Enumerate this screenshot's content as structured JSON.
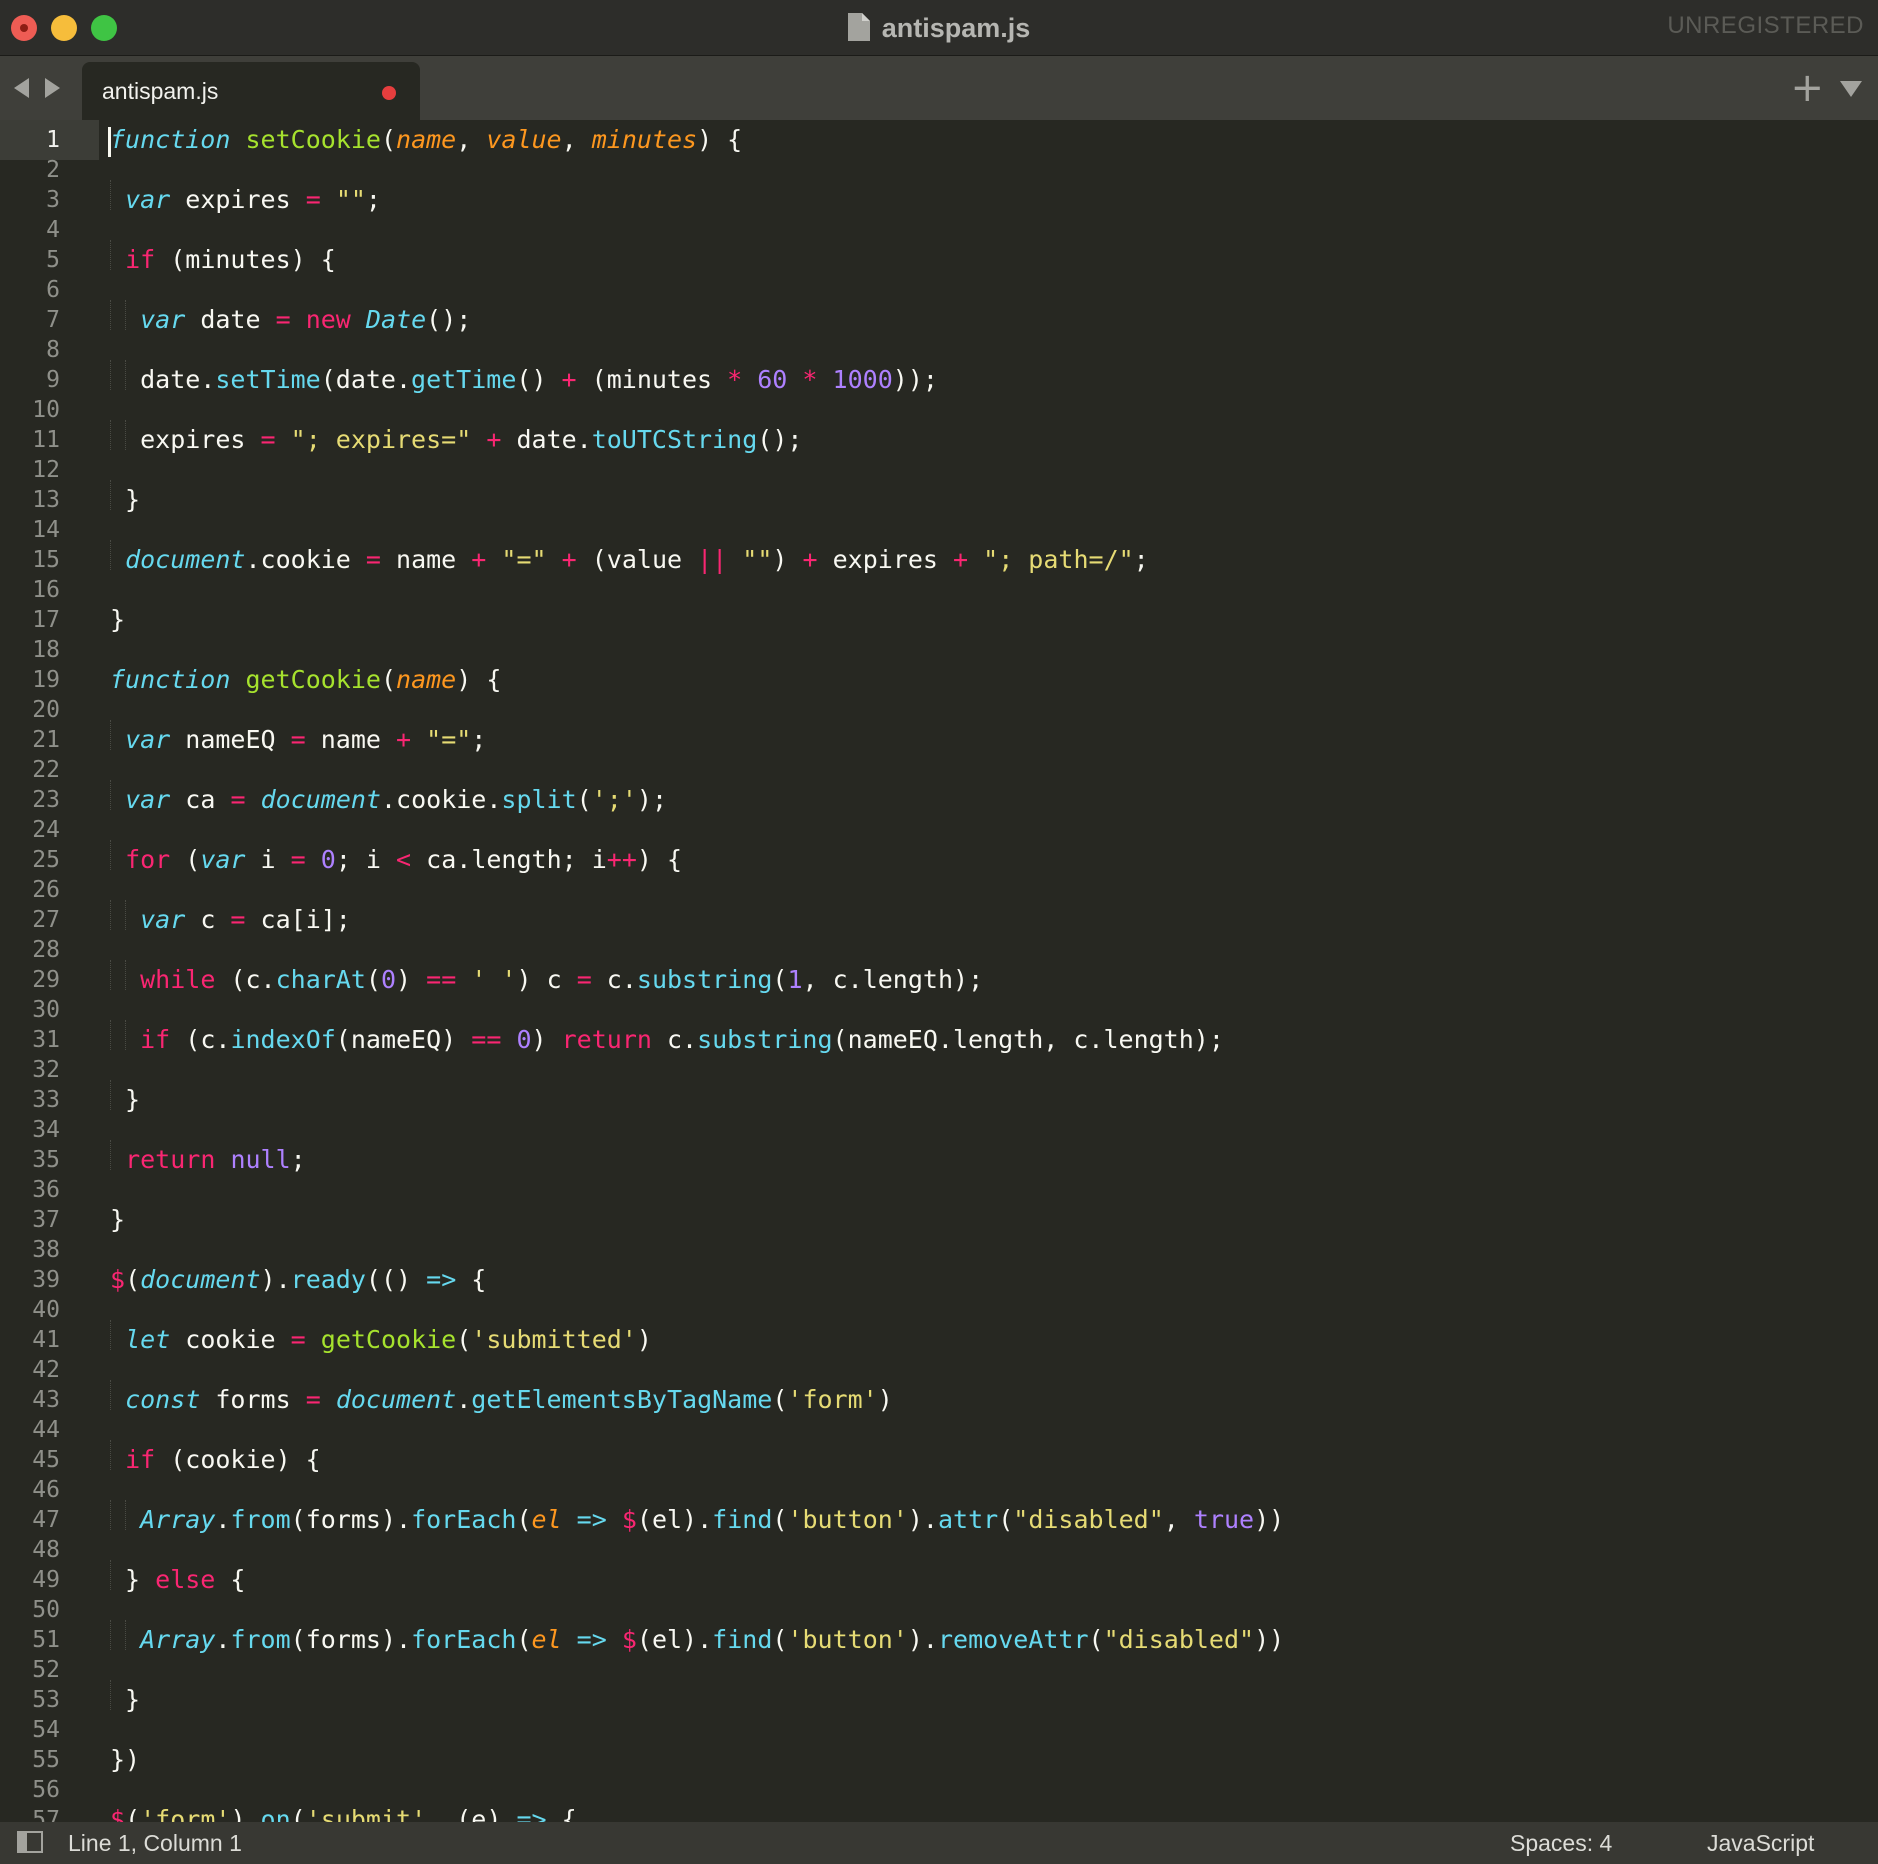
{
  "window": {
    "title": "antispam.js",
    "registration": "UNREGISTERED"
  },
  "tabs": [
    {
      "label": "antispam.js",
      "modified": true
    }
  ],
  "status": {
    "position": "Line 1, Column 1",
    "indent": "Spaces: 4",
    "syntax": "JavaScript"
  },
  "theme": {
    "background": "#272822",
    "keyword": "#f92672",
    "function": "#a6e22e",
    "string": "#e6db74",
    "number": "#ae81ff",
    "storage": "#66d9ef",
    "argument": "#fd971f"
  },
  "icons": {
    "file": "file-icon",
    "close": "close-window-button",
    "minimize": "minimize-window-button",
    "maximize": "maximize-window-button",
    "back": "nav-back-icon",
    "forward": "nav-forward-icon",
    "new_tab": "plus-icon",
    "tab_menu": "chevron-down-icon",
    "sidebar": "sidebar-toggle-icon"
  },
  "editor": {
    "line_count": 57,
    "lines": [
      "function setCookie(name, value, minutes) {",
      "",
      " var expires = \"\";",
      "",
      " if (minutes) {",
      "",
      "  var date = new Date();",
      "",
      "  date.setTime(date.getTime() + (minutes * 60 * 1000));",
      "",
      "  expires = \"; expires=\" + date.toUTCString();",
      "",
      " }",
      "",
      " document.cookie = name + \"=\" + (value || \"\") + expires + \"; path=/\";",
      "",
      "}",
      "",
      "function getCookie(name) {",
      "",
      " var nameEQ = name + \"=\";",
      "",
      " var ca = document.cookie.split(';');",
      "",
      " for (var i = 0; i < ca.length; i++) {",
      "",
      "  var c = ca[i];",
      "",
      "  while (c.charAt(0) == ' ') c = c.substring(1, c.length);",
      "",
      "  if (c.indexOf(nameEQ) == 0) return c.substring(nameEQ.length, c.length);",
      "",
      " }",
      "",
      " return null;",
      "",
      "}",
      "",
      "$(document).ready(() => {",
      "",
      " let cookie = getCookie('submitted')",
      "",
      " const forms = document.getElementsByTagName('form')",
      "",
      " if (cookie) {",
      "",
      "  Array.from(forms).forEach(el => $(el).find('button').attr(\"disabled\", true))",
      "",
      " } else {",
      "",
      "  Array.from(forms).forEach(el => $(el).find('button').removeAttr(\"disabled\"))",
      "",
      " }",
      "",
      "})",
      "",
      "$('form').on('submit', (e) => {"
    ]
  }
}
